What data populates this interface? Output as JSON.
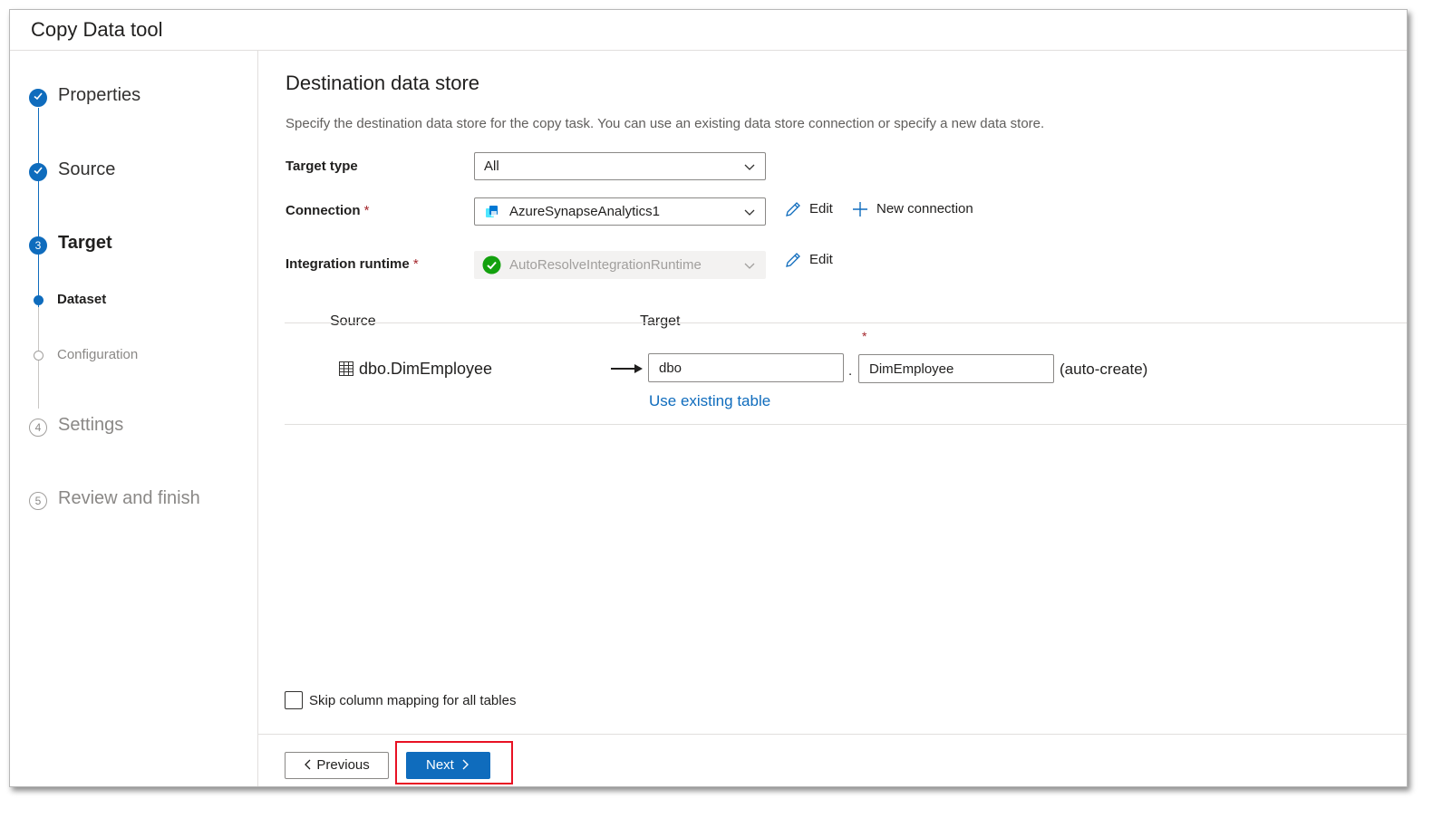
{
  "window": {
    "title": "Copy Data tool"
  },
  "steps": [
    {
      "number": "1",
      "label": "Properties",
      "state": "done"
    },
    {
      "number": "2",
      "label": "Source",
      "state": "done"
    },
    {
      "number": "3",
      "label": "Target",
      "state": "current"
    },
    {
      "number": "4",
      "label": "Settings",
      "state": "future"
    },
    {
      "number": "5",
      "label": "Review and finish",
      "state": "future"
    }
  ],
  "substeps": [
    {
      "label": "Dataset",
      "state": "current"
    },
    {
      "label": "Configuration",
      "state": "future"
    }
  ],
  "main": {
    "heading": "Destination data store",
    "description": "Specify the destination data store for the copy task. You can use an existing data store connection or specify a new data store.",
    "target_type": {
      "label": "Target type",
      "value": "All"
    },
    "connection": {
      "label": "Connection",
      "required": "*",
      "value": "AzureSynapseAnalytics1",
      "edit_label": "Edit",
      "new_label": "New connection"
    },
    "runtime": {
      "label": "Integration runtime",
      "required": "*",
      "value": "AutoResolveIntegrationRuntime",
      "edit_label": "Edit"
    },
    "mapping": {
      "source_header": "Source",
      "target_header": "Target",
      "rows": [
        {
          "source": "dbo.DimEmployee",
          "schema": "dbo",
          "separator": ".",
          "table": "DimEmployee",
          "required": "*",
          "note": "(auto-create)",
          "link": "Use existing table"
        }
      ]
    },
    "skip_mapping_label": "Skip column mapping for all tables"
  },
  "footer": {
    "previous_label": "Previous",
    "next_label": "Next"
  },
  "colors": {
    "accent": "#0f6cbd",
    "success": "#13a10e",
    "required": "#a4262c",
    "highlight": "#e81123"
  },
  "icons": {
    "done": "checkmark-icon",
    "connection": "synapse-icon",
    "runtime": "check-circle-icon",
    "edit": "pencil-icon",
    "add": "plus-icon",
    "table": "table-icon"
  }
}
